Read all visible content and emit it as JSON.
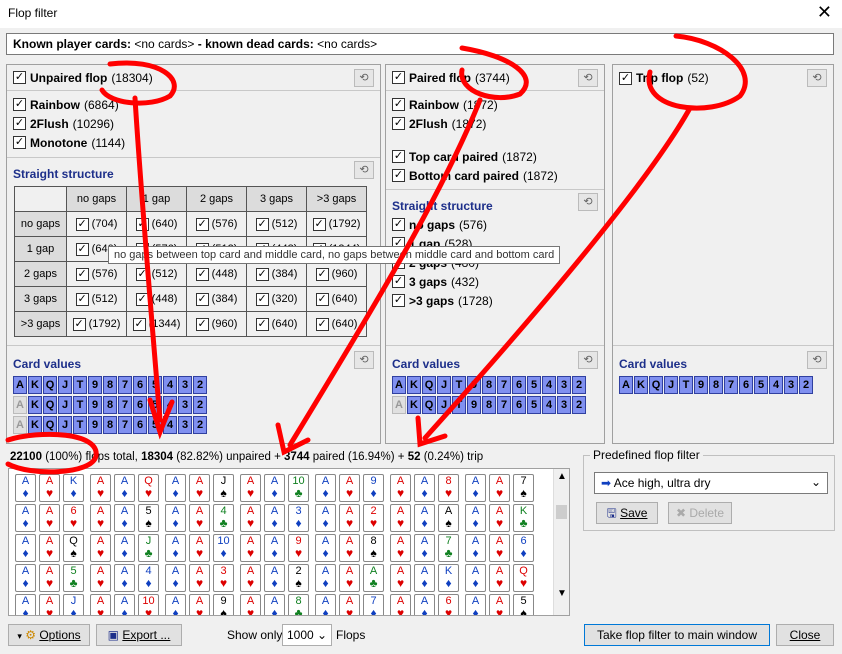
{
  "window": {
    "title": "Flop filter",
    "close": "✕"
  },
  "known": {
    "player_label": "Known player cards:",
    "player_value": "<no cards>",
    "sep": " - ",
    "dead_label": "known dead cards:",
    "dead_value": "<no cards>"
  },
  "unpaired": {
    "title": "Unpaired flop",
    "count": "(18304)",
    "items": [
      {
        "label": "Rainbow",
        "count": "(6864)"
      },
      {
        "label": "2Flush",
        "count": "(10296)"
      },
      {
        "label": "Monotone",
        "count": "(1144)"
      }
    ],
    "straight_title": "Straight structure",
    "cols": [
      "no gaps",
      "1 gap",
      "2 gaps",
      "3 gaps",
      ">3 gaps"
    ],
    "rows": [
      {
        "label": "no gaps",
        "cells": [
          "(704)",
          "(640)",
          "(576)",
          "(512)",
          "(1792)"
        ]
      },
      {
        "label": "1 gap",
        "cells": [
          "(640)",
          "(576)",
          "(512)",
          "(448)",
          "(1344)"
        ]
      },
      {
        "label": "2 gaps",
        "cells": [
          "(576)",
          "(512)",
          "(448)",
          "(384)",
          "(960)"
        ]
      },
      {
        "label": "3 gaps",
        "cells": [
          "(512)",
          "(448)",
          "(384)",
          "(320)",
          "(640)"
        ]
      },
      {
        "label": ">3 gaps",
        "cells": [
          "(1792)",
          "(1344)",
          "(960)",
          "(640)",
          "(640)"
        ]
      }
    ],
    "card_values_title": "Card values"
  },
  "paired": {
    "title": "Paired flop",
    "count": "(3744)",
    "items": [
      {
        "label": "Rainbow",
        "count": "(1872)"
      },
      {
        "label": "2Flush",
        "count": "(1872)"
      }
    ],
    "items2": [
      {
        "label": "Top card paired",
        "count": "(1872)"
      },
      {
        "label": "Bottom card paired",
        "count": "(1872)"
      }
    ],
    "straight_title": "Straight structure",
    "straight_items": [
      {
        "label": "no gaps",
        "count": "576"
      },
      {
        "label": "1 gap",
        "count": "528"
      },
      {
        "label": "2 gaps",
        "count": "480"
      },
      {
        "label": "3 gaps",
        "count": "432"
      },
      {
        "label": ">3 gaps",
        "count": "1728"
      }
    ],
    "card_values_title": "Card values"
  },
  "trip": {
    "title": "Trip flop",
    "count": "(52)",
    "card_values_title": "Card values"
  },
  "card_ranks": [
    "A",
    "K",
    "Q",
    "J",
    "T",
    "9",
    "8",
    "7",
    "6",
    "5",
    "4",
    "3",
    "2"
  ],
  "tooltip": "no gaps between top card and middle card, no gaps between middle card and bottom card",
  "totals": {
    "total": "22100",
    "total_pct": "(100%)",
    "t1": " flops total, ",
    "unpaired": "18304",
    "unpaired_pct": " (82.82%) unpaired + ",
    "paired": "3744",
    "paired_pct": " paired (16.94%) + ",
    "trip": "52",
    "trip_pct": " (0.24%) trip"
  },
  "predefined": {
    "label": "Predefined flop filter",
    "selected": "Ace high, ultra dry",
    "save": "Save",
    "delete": "Delete"
  },
  "bottom": {
    "options": "Options",
    "export": "Export ...",
    "show_only": "Show only",
    "count": "1000",
    "flops": "Flops",
    "take": "Take flop filter to main window",
    "close": "Close"
  },
  "colors": {
    "accent": "#1d2f8a",
    "card_value_bg": "#8090f0",
    "annotation": "#ff0000"
  }
}
